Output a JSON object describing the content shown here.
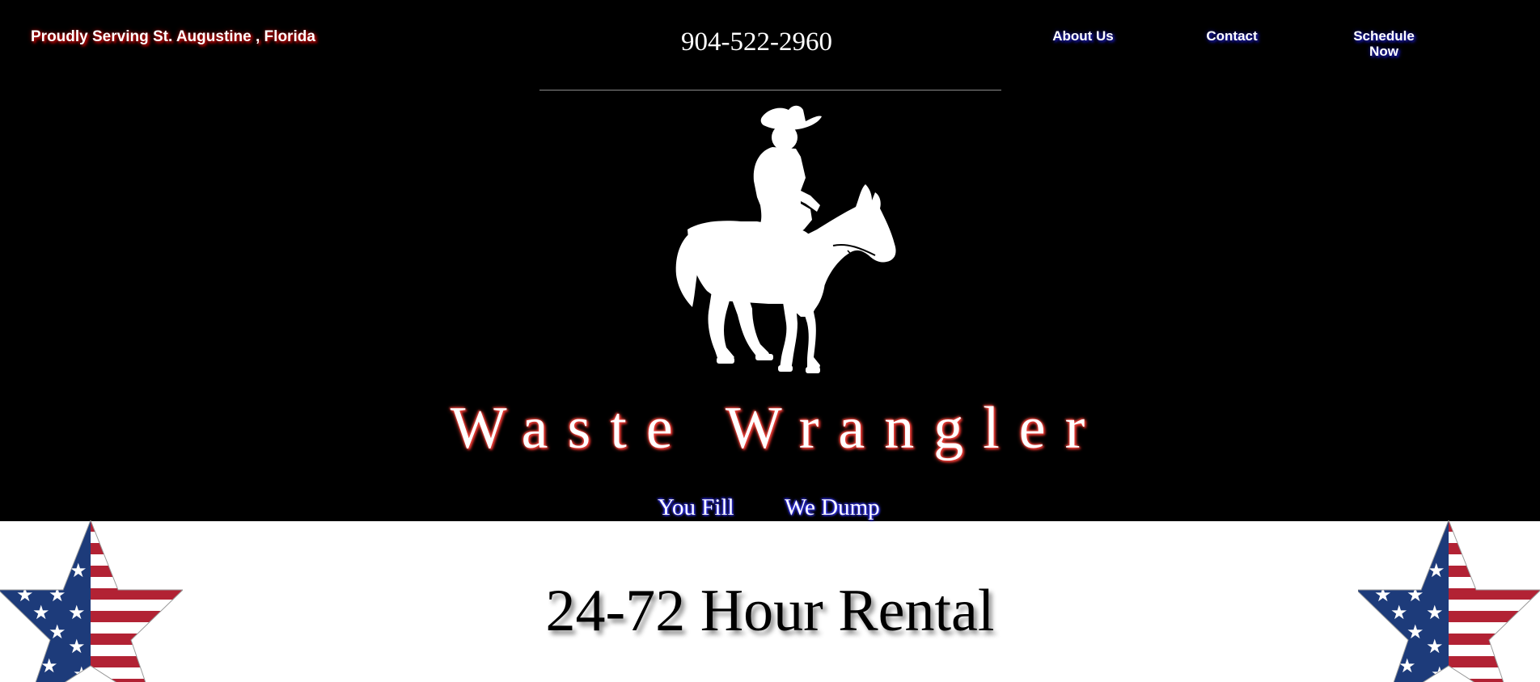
{
  "header": {
    "serving_text": "Proudly Serving St. Augustine , Florida",
    "phone": "904-522-2960"
  },
  "nav": {
    "about": "About Us",
    "contact": "Contact",
    "schedule": "Schedule Now"
  },
  "hero": {
    "brand_name": "Waste Wrangler",
    "tagline_fill": "You Fill",
    "tagline_dump": "We Dump"
  },
  "main": {
    "rental_heading": "24-72 Hour Rental"
  },
  "colors": {
    "hero_background": "#000000",
    "page_background": "#ffffff",
    "flag_red": "#b22234",
    "flag_blue": "#1d3b7a",
    "brand_glow": "#e8403a",
    "nav_glow": "#1a1aa0"
  },
  "icons": {
    "logo": "cowboy-on-horse-silhouette",
    "left_decoration": "american-flag-star",
    "right_decoration": "american-flag-star"
  }
}
